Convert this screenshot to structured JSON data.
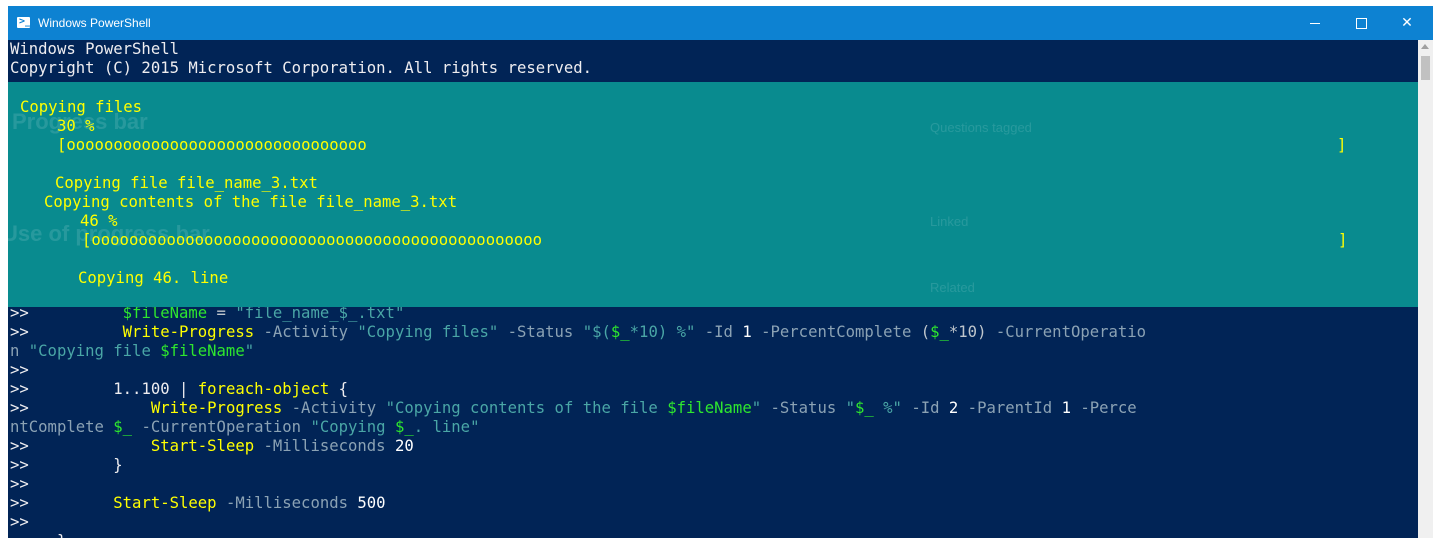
{
  "window": {
    "title": "Windows PowerShell",
    "icon": "powershell-icon",
    "controls": {
      "minimize_icon": "minimize-icon",
      "maximize_icon": "maximize-icon",
      "close_label": "✕"
    }
  },
  "colors": {
    "console_background": "#012456",
    "titlebar_background": "#0d82d2",
    "progress_background": "#098b8f",
    "progress_text": "#ffff00"
  },
  "console": {
    "header_line_1": "Windows PowerShell",
    "header_line_2": "Copyright (C) 2015 Microsoft Corporation. All rights reserved.",
    "script": {
      "l1_prompt": ">>",
      "l1_var": "$fileName",
      "l1_op": " = ",
      "l1_str": "\"file_name_$_.txt\"",
      "l2_prompt": ">>",
      "l2_cmd": "Write-Progress",
      "l2_p1": " -Activity ",
      "l2_s1": "\"Copying files\"",
      "l2_p2": " -Status ",
      "l2_s2a": "\"$(",
      "l2_v2": "$_",
      "l2_s2b": "*10) %\"",
      "l2_p3": " -Id ",
      "l2_n3": "1",
      "l2_p4": " -PercentComplete ",
      "l2_o4a": "(",
      "l2_v4": "$_",
      "l2_o4b": "*10)",
      "l2_p5": " -CurrentOperatio",
      "l3_wrap": "n ",
      "l3_s1": "\"Copying file ",
      "l3_v1": "$fileName",
      "l3_s2": "\"",
      "l4_prompt": ">>",
      "l5_prompt": ">>",
      "l5_range": "1..100",
      "l5_pipe": " | ",
      "l5_cmd": "foreach-object",
      "l5_brace": " {",
      "l6_prompt": ">>",
      "l6_cmd": "Write-Progress",
      "l6_p1": " -Activity ",
      "l6_s1": "\"Copying contents of the file ",
      "l6_v1": "$fileName",
      "l6_s2": "\"",
      "l6_p2": " -Status ",
      "l6_s3a": "\"",
      "l6_v3": "$_",
      "l6_s3b": " %\"",
      "l6_p3": " -Id ",
      "l6_n3": "2",
      "l6_p4": " -ParentId ",
      "l6_n4": "1",
      "l6_p5": " -Perce",
      "l7_wrap": "ntComplete ",
      "l7_v1": "$_",
      "l7_p1": " -CurrentOperation ",
      "l7_s1": "\"Copying ",
      "l7_v2": "$_",
      "l7_s2": ". line\"",
      "l8_prompt": ">>",
      "l8_cmd": "Start-Sleep",
      "l8_p1": " -Milliseconds ",
      "l8_n1": "20",
      "l9_prompt": ">>",
      "l9_brace": "}",
      "l10_prompt": ">>",
      "l11_prompt": ">>",
      "l11_cmd": "Start-Sleep",
      "l11_p1": " -Milliseconds ",
      "l11_n1": "500",
      "l12_prompt": ">>",
      "l13_brace": "}"
    }
  },
  "progress": {
    "outer": {
      "activity": "Copying files",
      "status": "30 %",
      "bar_open": "[",
      "bar_fill": "oooooooooooooooooooooooooooooooo",
      "bar_close": "]",
      "percent_complete": 30,
      "current_operation": "Copying file file_name_3.txt"
    },
    "inner": {
      "activity": "Copying contents of the file file_name_3.txt",
      "status": "46 %",
      "bar_open": "[",
      "bar_fill": "oooooooooooooooooooooooooooooooooooooooooooooooo",
      "bar_close": "]",
      "percent_complete": 46,
      "current_operation": "Copying 46. line"
    }
  },
  "background_window": {
    "heading_1": "Progress bar",
    "heading_2": "Use of progress bar",
    "side_1": "Questions tagged",
    "side_2": "Linked",
    "side_3": "Related"
  }
}
